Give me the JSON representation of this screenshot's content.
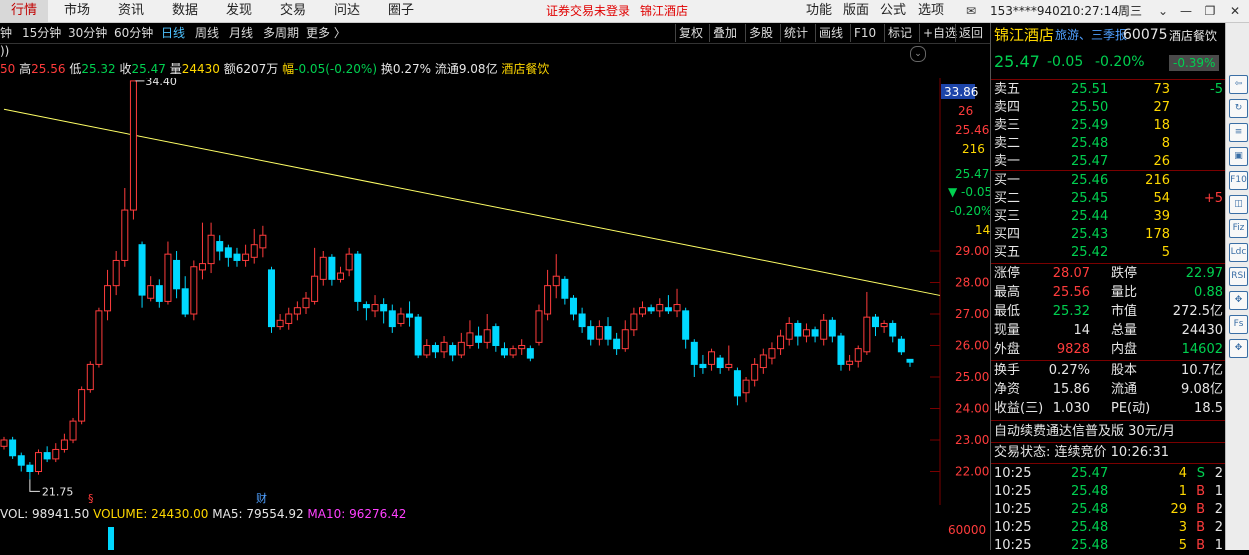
{
  "menu": {
    "items": [
      "行情",
      "市场",
      "资讯",
      "数据",
      "发现",
      "交易",
      "问达",
      "圈子"
    ],
    "alert": "证券交易未登录",
    "stock_name": "锦江酒店",
    "right_items": [
      "功能",
      "版面",
      "公式",
      "选项"
    ],
    "account": "153****9402",
    "time": "10:27:14",
    "weekday": "周三"
  },
  "periods": [
    "钟",
    "15分钟",
    "30分钟",
    "60分钟",
    "日线",
    "周线",
    "月线",
    "多周期",
    "更多 〉"
  ],
  "active_period": "日线",
  "tools": [
    "复权",
    "叠加",
    "多股",
    "统计",
    "画线",
    "F10",
    "标记",
    "+自选",
    "返回"
  ],
  "infoline": {
    "open": "50",
    "high_label": "高",
    "high": "25.56",
    "low_label": "低",
    "low": "25.32",
    "close_label": "收",
    "close": "25.47",
    "vol_label": "量",
    "vol": "24430",
    "amt_label": "额",
    "amt": "6207万",
    "chg_label": "幅",
    "chg": "-0.05(-0.20%)",
    "turn_label": "换",
    "turn": "0.27%",
    "float_label": "流通",
    "float": "9.08亿",
    "sector": "酒店餐饮"
  },
  "chart_data": {
    "type": "candlestick",
    "title": "",
    "y_range": [
      21.5,
      34.5
    ],
    "y_ticks": [
      "29.00",
      "28.00",
      "27.00",
      "26.00",
      "25.00",
      "24.00",
      "23.00",
      "22.00"
    ],
    "annotations": {
      "high_label": "34.40",
      "low_label": "21.75"
    },
    "trendline": {
      "from": [
        0,
        33.5
      ],
      "to": [
        156,
        25.0
      ],
      "color": "#ffff66"
    },
    "candles": [
      [
        22.8,
        23.0,
        22.7,
        23.1
      ],
      [
        23.0,
        22.5,
        22.4,
        23.1
      ],
      [
        22.5,
        22.2,
        22.0,
        22.6
      ],
      [
        22.2,
        22.0,
        21.75,
        22.3
      ],
      [
        22.0,
        22.6,
        21.9,
        22.7
      ],
      [
        22.6,
        22.4,
        22.3,
        22.8
      ],
      [
        22.4,
        22.7,
        22.3,
        22.9
      ],
      [
        22.7,
        23.0,
        22.6,
        23.2
      ],
      [
        23.0,
        23.6,
        22.9,
        23.7
      ],
      [
        23.6,
        24.6,
        23.5,
        24.7
      ],
      [
        24.6,
        25.4,
        24.5,
        25.5
      ],
      [
        25.4,
        27.1,
        25.3,
        27.2
      ],
      [
        27.1,
        27.9,
        26.8,
        28.4
      ],
      [
        27.9,
        28.7,
        27.6,
        29.0
      ],
      [
        28.7,
        30.3,
        28.5,
        31.0
      ],
      [
        30.3,
        34.4,
        30.0,
        34.4
      ],
      [
        29.2,
        27.6,
        27.2,
        29.3
      ],
      [
        27.5,
        27.9,
        27.4,
        28.2
      ],
      [
        27.9,
        27.4,
        27.2,
        28.1
      ],
      [
        27.4,
        28.9,
        27.3,
        29.3
      ],
      [
        28.7,
        27.8,
        27.5,
        29.0
      ],
      [
        27.8,
        27.0,
        26.9,
        28.2
      ],
      [
        27.0,
        28.5,
        26.8,
        28.7
      ],
      [
        28.4,
        28.6,
        28.1,
        29.9
      ],
      [
        28.6,
        29.5,
        28.3,
        29.9
      ],
      [
        29.3,
        29.0,
        28.7,
        29.5
      ],
      [
        29.1,
        28.8,
        28.5,
        29.2
      ],
      [
        28.9,
        28.7,
        28.5,
        29.1
      ],
      [
        28.7,
        28.9,
        28.5,
        29.2
      ],
      [
        28.8,
        29.2,
        28.6,
        29.7
      ],
      [
        29.1,
        29.5,
        28.8,
        29.8
      ],
      [
        28.4,
        26.6,
        26.4,
        28.5
      ],
      [
        26.6,
        26.8,
        26.5,
        27.0
      ],
      [
        26.7,
        27.0,
        26.5,
        27.2
      ],
      [
        27.0,
        27.2,
        26.8,
        27.4
      ],
      [
        27.2,
        27.5,
        27.0,
        27.7
      ],
      [
        27.4,
        28.2,
        27.3,
        29.1
      ],
      [
        28.1,
        28.8,
        27.9,
        29.0
      ],
      [
        28.8,
        28.1,
        27.9,
        28.9
      ],
      [
        28.1,
        28.3,
        28.0,
        28.5
      ],
      [
        28.4,
        28.9,
        28.2,
        29.1
      ],
      [
        28.9,
        27.4,
        27.1,
        29.0
      ],
      [
        27.3,
        27.2,
        26.8,
        27.4
      ],
      [
        27.1,
        27.3,
        26.9,
        27.6
      ],
      [
        27.3,
        27.1,
        26.7,
        27.5
      ],
      [
        27.1,
        26.6,
        26.4,
        27.3
      ],
      [
        26.7,
        27.0,
        26.6,
        27.2
      ],
      [
        27.0,
        26.9,
        26.6,
        27.4
      ],
      [
        26.9,
        25.7,
        25.6,
        27.0
      ],
      [
        25.7,
        26.0,
        25.6,
        26.2
      ],
      [
        26.0,
        25.8,
        25.6,
        26.1
      ],
      [
        25.8,
        26.1,
        25.6,
        26.3
      ],
      [
        26.0,
        25.7,
        25.5,
        26.1
      ],
      [
        25.7,
        26.1,
        25.6,
        26.4
      ],
      [
        26.0,
        26.4,
        25.9,
        26.8
      ],
      [
        26.3,
        26.1,
        25.9,
        26.6
      ],
      [
        26.1,
        26.5,
        25.9,
        27.0
      ],
      [
        26.6,
        26.0,
        25.8,
        26.7
      ],
      [
        25.9,
        25.7,
        25.6,
        26.1
      ],
      [
        25.7,
        25.9,
        25.6,
        26.0
      ],
      [
        25.9,
        26.0,
        25.7,
        26.2
      ],
      [
        25.9,
        25.6,
        25.5,
        26.0
      ],
      [
        26.1,
        27.1,
        26.0,
        27.3
      ],
      [
        27.0,
        27.9,
        26.8,
        28.4
      ],
      [
        27.9,
        28.2,
        27.5,
        28.9
      ],
      [
        28.1,
        27.5,
        27.3,
        28.2
      ],
      [
        27.5,
        27.0,
        26.8,
        27.6
      ],
      [
        27.0,
        26.6,
        26.4,
        27.2
      ],
      [
        26.6,
        26.2,
        26.0,
        26.8
      ],
      [
        26.2,
        26.6,
        26.0,
        26.8
      ],
      [
        26.6,
        26.2,
        26.0,
        26.9
      ],
      [
        26.2,
        25.9,
        25.7,
        26.4
      ],
      [
        25.9,
        26.5,
        25.8,
        26.8
      ],
      [
        26.5,
        27.0,
        26.3,
        27.2
      ],
      [
        27.0,
        27.2,
        26.9,
        27.4
      ],
      [
        27.2,
        27.1,
        27.0,
        27.3
      ],
      [
        27.1,
        27.3,
        26.9,
        27.5
      ],
      [
        27.2,
        27.1,
        27.0,
        27.6
      ],
      [
        27.1,
        27.3,
        26.9,
        27.8
      ],
      [
        27.1,
        26.2,
        25.9,
        27.2
      ],
      [
        26.1,
        25.4,
        25.0,
        26.2
      ],
      [
        25.4,
        25.3,
        25.1,
        25.7
      ],
      [
        25.4,
        25.8,
        25.2,
        25.9
      ],
      [
        25.6,
        25.3,
        25.1,
        25.7
      ],
      [
        25.3,
        25.4,
        25.2,
        26.0
      ],
      [
        25.2,
        24.4,
        24.1,
        25.3
      ],
      [
        24.5,
        24.9,
        24.2,
        25.0
      ],
      [
        24.9,
        25.4,
        24.7,
        25.6
      ],
      [
        25.3,
        25.7,
        25.1,
        25.9
      ],
      [
        25.6,
        25.9,
        25.4,
        26.1
      ],
      [
        25.9,
        26.3,
        25.7,
        26.5
      ],
      [
        26.2,
        26.7,
        26.0,
        26.9
      ],
      [
        26.7,
        26.3,
        26.0,
        26.8
      ],
      [
        26.3,
        26.5,
        26.1,
        26.7
      ],
      [
        26.5,
        26.3,
        26.1,
        26.6
      ],
      [
        26.2,
        26.8,
        26.0,
        27.0
      ],
      [
        26.8,
        26.3,
        26.1,
        26.9
      ],
      [
        26.3,
        25.4,
        25.2,
        26.4
      ],
      [
        25.4,
        25.5,
        25.2,
        25.7
      ],
      [
        25.5,
        25.9,
        25.3,
        26.0
      ],
      [
        25.8,
        26.9,
        25.7,
        27.7
      ],
      [
        26.9,
        26.6,
        26.3,
        27.0
      ],
      [
        26.6,
        26.7,
        26.4,
        26.8
      ],
      [
        26.7,
        26.3,
        26.1,
        26.8
      ],
      [
        26.2,
        25.8,
        25.7,
        26.3
      ],
      [
        25.56,
        25.47,
        25.32,
        25.56
      ]
    ],
    "right_scale": {
      "top_price": "33.86",
      "row1": "26",
      "row2": "25.46",
      "row3": "216",
      "row4": "25.47",
      "row5": "▼ -0.05",
      "row6": "-0.20%",
      "row7": "14",
      "vol_tick": "60000"
    },
    "markers": {
      "left": "§",
      "fin": "财"
    }
  },
  "volume_line": {
    "vol": "VOL: 98941.50",
    "volume": "VOLUME: 24430.00",
    "ma5": "MA5: 79554.92",
    "ma10": "MA10: 96276.42"
  },
  "quote": {
    "name": "锦江酒店",
    "tags": "旅游、三季报",
    "code": "60075",
    "sector": "酒店餐饮",
    "price": "25.47",
    "change": "-0.05",
    "change_pct": "-0.20%",
    "sector_chg": "-0.39%",
    "asks": [
      {
        "label": "卖五",
        "price": "25.51",
        "vol": "73",
        "extra": "-5"
      },
      {
        "label": "卖四",
        "price": "25.50",
        "vol": "27",
        "extra": ""
      },
      {
        "label": "卖三",
        "price": "25.49",
        "vol": "18",
        "extra": ""
      },
      {
        "label": "卖二",
        "price": "25.48",
        "vol": "8",
        "extra": ""
      },
      {
        "label": "卖一",
        "price": "25.47",
        "vol": "26",
        "extra": ""
      }
    ],
    "bids": [
      {
        "label": "买一",
        "price": "25.46",
        "vol": "216",
        "extra": ""
      },
      {
        "label": "买二",
        "price": "25.45",
        "vol": "54",
        "extra": "+5"
      },
      {
        "label": "买三",
        "price": "25.44",
        "vol": "39",
        "extra": ""
      },
      {
        "label": "买四",
        "price": "25.43",
        "vol": "178",
        "extra": ""
      },
      {
        "label": "买五",
        "price": "25.42",
        "vol": "5",
        "extra": ""
      }
    ],
    "stats": [
      {
        "l1": "涨停",
        "v1": "28.07",
        "l2": "跌停",
        "v2": "22.97",
        "c1": "red",
        "c2": "green"
      },
      {
        "l1": "最高",
        "v1": "25.56",
        "l2": "量比",
        "v2": "0.88",
        "c1": "red",
        "c2": "green"
      },
      {
        "l1": "最低",
        "v1": "25.32",
        "l2": "市值",
        "v2": "272.5亿",
        "c1": "green",
        "c2": "white"
      },
      {
        "l1": "现量",
        "v1": "14",
        "l2": "总量",
        "v2": "24430",
        "c1": "white",
        "c2": "white"
      },
      {
        "l1": "外盘",
        "v1": "9828",
        "l2": "内盘",
        "v2": "14602",
        "c1": "red",
        "c2": "green"
      }
    ],
    "stats2": [
      {
        "l1": "换手",
        "v1": "0.27%",
        "l2": "股本",
        "v2": "10.7亿"
      },
      {
        "l1": "净资",
        "v1": "15.86",
        "l2": "流通",
        "v2": "9.08亿"
      },
      {
        "l1": "收益(三)",
        "v1": "1.030",
        "l2": "PE(动)",
        "v2": "18.5"
      }
    ],
    "promo": "自动续费通达信普及版  30元/月",
    "status": "交易状态: 连续竞价  10:26:31",
    "ticks": [
      {
        "time": "10:25",
        "price": "25.47",
        "vol": "4",
        "side": "S",
        "n": "2"
      },
      {
        "time": "10:25",
        "price": "25.48",
        "vol": "1",
        "side": "B",
        "n": "1"
      },
      {
        "time": "10:25",
        "price": "25.48",
        "vol": "29",
        "side": "B",
        "n": "2"
      },
      {
        "time": "10:25",
        "price": "25.48",
        "vol": "3",
        "side": "B",
        "n": "2"
      },
      {
        "time": "10:25",
        "price": "25.48",
        "vol": "5",
        "side": "B",
        "n": "1"
      }
    ]
  },
  "sidebar_icons": [
    "back-icon",
    "refresh-icon",
    "list-icon",
    "cmp-icon",
    "f10-icon",
    "chart-icon",
    "fiz-icon",
    "ldc-icon",
    "rsi-icon",
    "move-icon",
    "fs-icon",
    "target-icon"
  ],
  "sidebar_labels": [
    "⇦",
    "↻",
    "≡",
    "▣",
    "F10",
    "◫",
    "Fiz",
    "Ldc",
    "RSI",
    "✥",
    "Fs",
    "✥"
  ],
  "colors": {
    "up": "#ff3c3c",
    "down": "#00d8ff",
    "trend": "#ffff66",
    "grid": "#7a0000"
  }
}
